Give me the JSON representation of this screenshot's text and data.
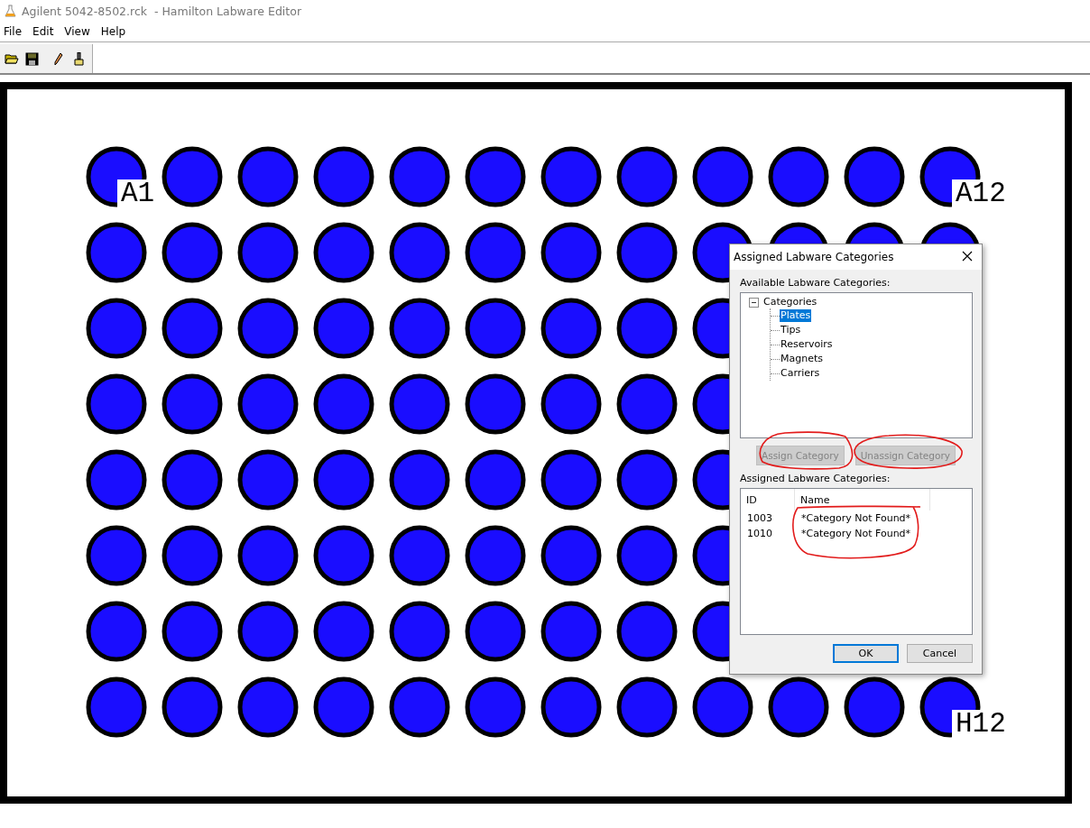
{
  "window": {
    "title": "Agilent 5042-8502.rck  - Hamilton Labware Editor"
  },
  "menu": [
    "File",
    "Edit",
    "View",
    "Help"
  ],
  "toolbar": [
    {
      "kind": "open"
    },
    {
      "kind": "save"
    },
    {
      "kind": "pencil"
    },
    {
      "kind": "brush"
    }
  ],
  "plate": {
    "labels": [
      "A1",
      "A12",
      "H12"
    ]
  },
  "dialog": {
    "title": "Assigned Labware Categories",
    "available_label": "Available Labware Categories:",
    "tree": {
      "label": "Categories",
      "expanded": true,
      "children": [
        {
          "label": "Plates",
          "selected": true
        },
        {
          "label": "Tips",
          "selected": false
        },
        {
          "label": "Reservoirs",
          "selected": false
        },
        {
          "label": "Magnets",
          "selected": false
        },
        {
          "label": "Carriers",
          "selected": false
        }
      ]
    },
    "actions": [
      {
        "label": "Assign Category",
        "disabled": true
      },
      {
        "label": "Unassign Category",
        "disabled": true
      }
    ],
    "assigned_label": "Assigned Labware Categories:",
    "list": {
      "columns": [
        "ID",
        "Name"
      ],
      "rows": [
        {
          "cells": [
            "1003",
            "*Category Not Found*"
          ]
        },
        {
          "cells": [
            "1010",
            "*Category Not Found*"
          ]
        }
      ]
    },
    "buttons": [
      {
        "label": "OK",
        "default": true
      },
      {
        "label": "Cancel",
        "default": false
      }
    ]
  }
}
